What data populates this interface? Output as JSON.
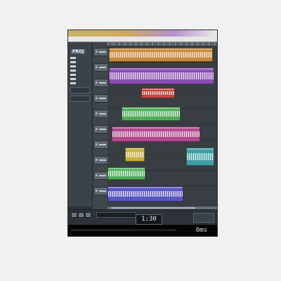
{
  "app": {
    "title": "",
    "accent": "#c8b266"
  },
  "inspector": {
    "header": "PROJ",
    "rows": [
      "",
      "",
      "",
      "",
      "",
      "",
      ""
    ]
  },
  "transport": {
    "timecode": "1:30"
  },
  "status": {
    "text": "0ms"
  },
  "colors": {
    "orange": "#c98a3a",
    "purple": "#8a4fb3",
    "red": "#c2463f",
    "green": "#4fae5a",
    "magenta": "#b34a8f",
    "teal": "#3f9fa6",
    "yellow": "#c6b13c",
    "blue": "#5a56c4"
  },
  "clips": [
    {
      "label": "",
      "color": "#c98a3a"
    },
    {
      "label": "",
      "color": "#8a4fb3"
    },
    {
      "label": "",
      "color": "#c2463f"
    },
    {
      "label": "",
      "color": "#4fae5a"
    },
    {
      "label": "",
      "color": "#b34a8f"
    },
    {
      "label": "",
      "color": "#c6b13c"
    },
    {
      "label": "",
      "color": "#3f9fa6"
    },
    {
      "label": "",
      "color": "#4fae5a"
    },
    {
      "label": "",
      "color": "#5a56c4"
    }
  ]
}
